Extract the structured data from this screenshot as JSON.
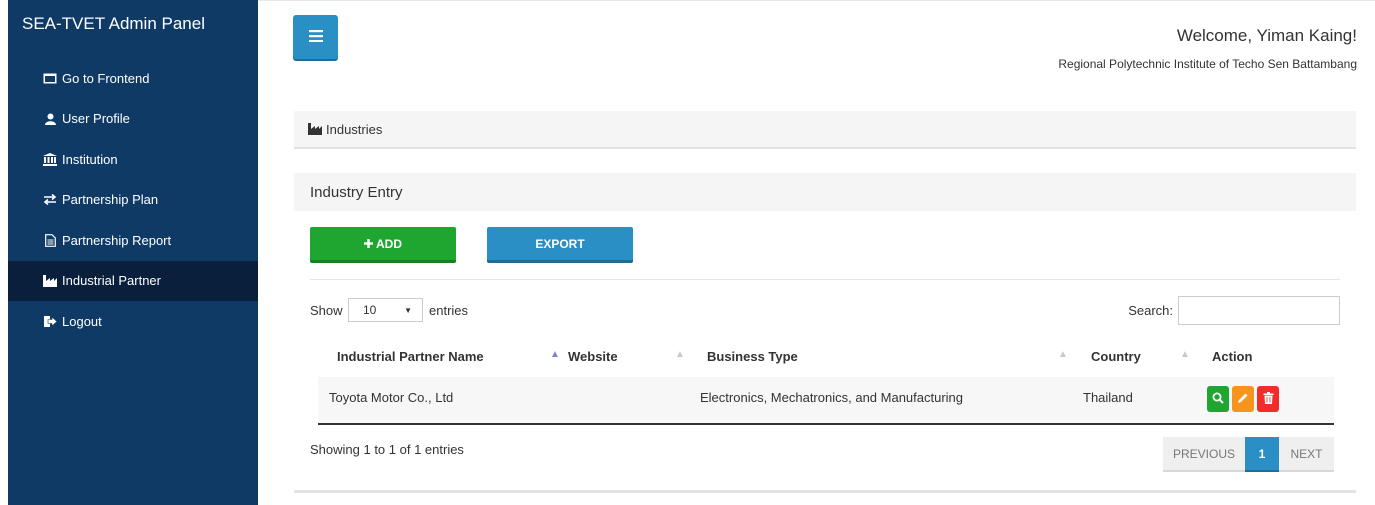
{
  "sidebar": {
    "brand": "SEA-TVET Admin Panel",
    "items": [
      {
        "label": "Go to Frontend",
        "icon": "window-icon"
      },
      {
        "label": "User Profile",
        "icon": "user-icon"
      },
      {
        "label": "Institution",
        "icon": "institution-icon"
      },
      {
        "label": "Partnership Plan",
        "icon": "exchange-icon"
      },
      {
        "label": "Partnership Report",
        "icon": "document-icon"
      },
      {
        "label": "Industrial Partner",
        "icon": "factory-icon",
        "active": true
      },
      {
        "label": "Logout",
        "icon": "logout-icon"
      }
    ]
  },
  "header": {
    "welcome": "Welcome, Yiman Kaing!",
    "institute": "Regional Polytechnic Institute of Techo Sen Battambang",
    "menu_icon": "hamburger-icon"
  },
  "breadcrumb": {
    "label": "Industries",
    "icon": "factory-icon"
  },
  "panel": {
    "title": "Industry Entry",
    "add_label": "ADD",
    "export_label": "EXPORT",
    "show_label": "Show",
    "page_size": "10",
    "entries_label": "entries",
    "search_label": "Search:"
  },
  "table": {
    "columns": [
      "Industrial Partner Name",
      "Website",
      "Business Type",
      "Country",
      "Action"
    ],
    "rows": [
      {
        "name": "Toyota Motor Co., Ltd",
        "website": "",
        "business_type": "Electronics, Mechatronics, and Manufacturing",
        "country": "Thailand"
      }
    ]
  },
  "footer": {
    "info": "Showing 1 to 1 of 1 entries",
    "prev": "PREVIOUS",
    "page": "1",
    "next": "NEXT"
  },
  "colors": {
    "sidebar": "#0f3a66",
    "sidebar_active": "#0a1f3b",
    "primary": "#2a8fc4",
    "success": "#1fa631",
    "warning": "#f7941d",
    "danger": "#f22b2b"
  }
}
